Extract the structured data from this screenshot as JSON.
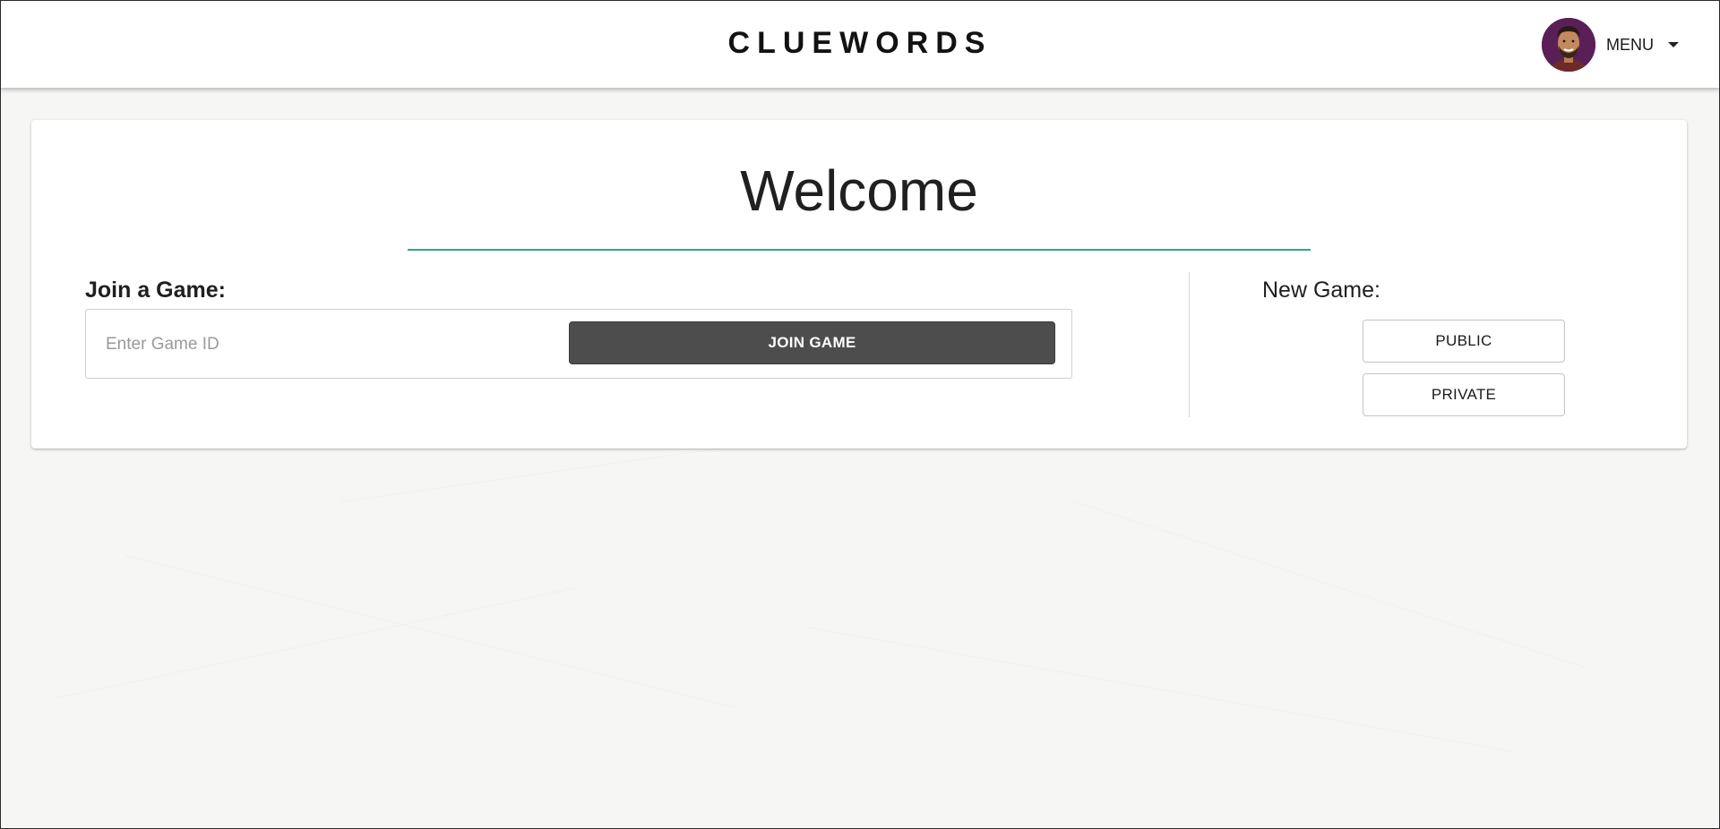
{
  "header": {
    "brand": "CLUEWORDS",
    "menu_label": "MENU",
    "avatar_icon": "user-avatar-photo"
  },
  "welcome": {
    "title": "Welcome"
  },
  "join": {
    "heading": "Join a Game:",
    "input_placeholder": "Enter Game ID",
    "input_value": "",
    "button_label": "JOIN GAME"
  },
  "new_game": {
    "heading": "New Game:",
    "public_label": "PUBLIC",
    "private_label": "PRIVATE"
  },
  "colors": {
    "accent_rule": "#2bab7a",
    "join_button_bg": "#4d4d4d",
    "page_bg": "#f6f6f4"
  }
}
